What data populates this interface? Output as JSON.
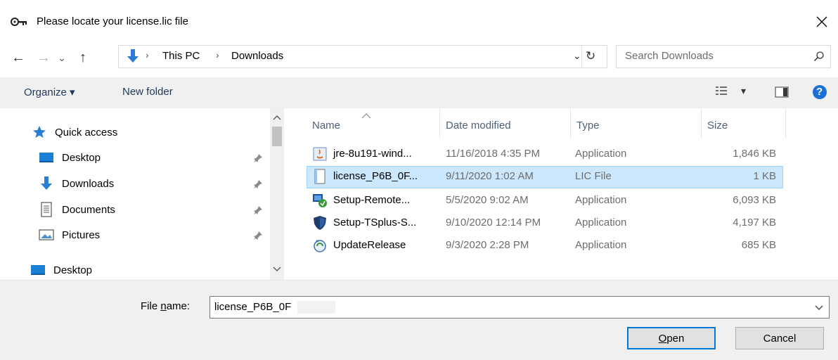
{
  "window": {
    "title": "Please locate your license.lic file",
    "close_glyph": "✕"
  },
  "nav": {
    "back": "←",
    "forward": "→",
    "recent": "⌄",
    "up": "↑"
  },
  "address": {
    "crumbs": [
      "This PC",
      "Downloads"
    ],
    "separator": "›",
    "dropdown": "⌄",
    "refresh": "↻"
  },
  "search": {
    "placeholder": "Search Downloads"
  },
  "toolbar": {
    "organize": "Organize ▾",
    "new_folder": "New folder",
    "view_dropdown": "▾",
    "help": "?"
  },
  "sidebar": {
    "items": [
      {
        "label": "Quick access",
        "icon": "star-icon"
      },
      {
        "label": "Desktop",
        "icon": "desktop-icon",
        "pinned": true
      },
      {
        "label": "Downloads",
        "icon": "download-icon",
        "pinned": true
      },
      {
        "label": "Documents",
        "icon": "document-icon",
        "pinned": true
      },
      {
        "label": "Pictures",
        "icon": "pictures-icon",
        "pinned": true
      },
      {
        "label": "Desktop",
        "icon": "desktop-icon"
      }
    ]
  },
  "filelist": {
    "columns": [
      "Name",
      "Date modified",
      "Type",
      "Size"
    ],
    "rows": [
      {
        "name": "jre-8u191-wind...",
        "date": "11/16/2018 4:35 PM",
        "type": "Application",
        "size": "1,846 KB",
        "icon": "java-installer-icon"
      },
      {
        "name": "license_P6B_0F...",
        "date": "9/11/2020 1:02 AM",
        "type": "LIC File",
        "size": "1 KB",
        "icon": "lic-file-icon",
        "selected": true
      },
      {
        "name": "Setup-Remote...",
        "date": "5/5/2020 9:02 AM",
        "type": "Application",
        "size": "6,093 KB",
        "icon": "setup-remote-icon"
      },
      {
        "name": "Setup-TSplus-S...",
        "date": "9/10/2020 12:14 PM",
        "type": "Application",
        "size": "4,197 KB",
        "icon": "shield-icon"
      },
      {
        "name": "UpdateRelease",
        "date": "9/3/2020 2:28 PM",
        "type": "Application",
        "size": "685 KB",
        "icon": "update-icon"
      }
    ]
  },
  "footer": {
    "filename_label_pre": "File ",
    "filename_label_u": "n",
    "filename_label_post": "ame:",
    "filename_value": "license_P6B_0F",
    "open_pre": "",
    "open_u": "O",
    "open_post": "pen",
    "cancel": "Cancel"
  },
  "colors": {
    "accent": "#0078d7",
    "selection": "#cce8ff",
    "toolbar_bg": "#f0f0f0"
  }
}
